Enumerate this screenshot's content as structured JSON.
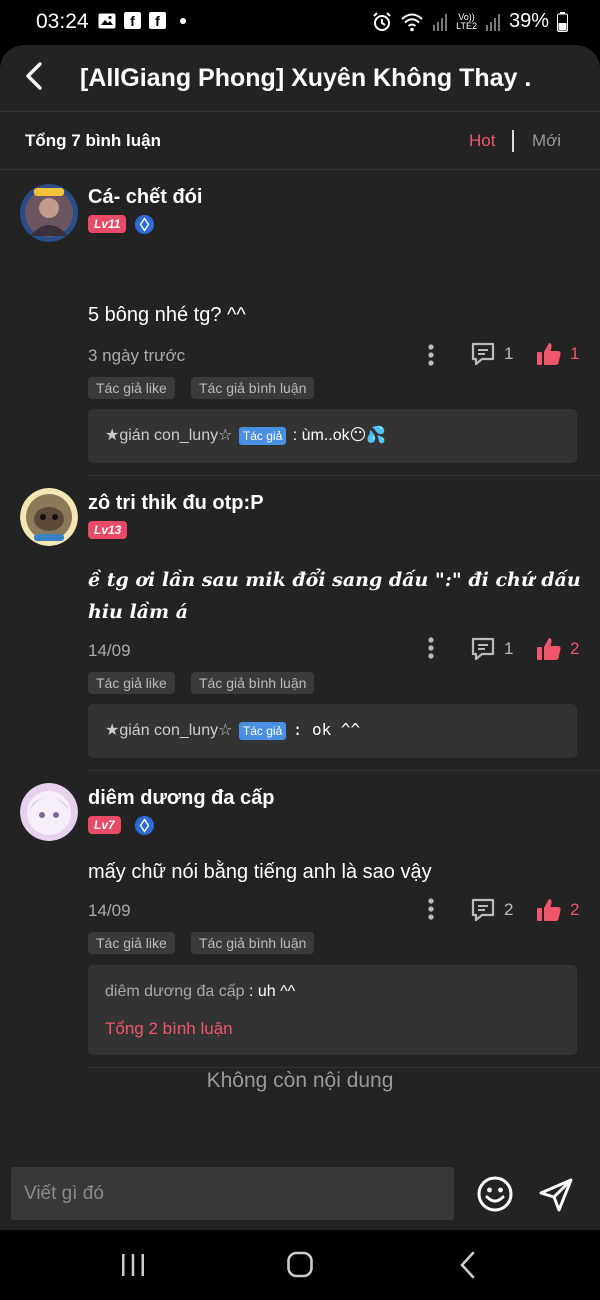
{
  "status_bar": {
    "time": "03:24",
    "app_icons": [
      "image-icon",
      "facebook-icon",
      "facebook-icon"
    ],
    "network_label_top": "Vo))",
    "network_label_bottom": "LTE2",
    "battery": "39%"
  },
  "header": {
    "title": "[AllGiang Phong] Xuyên Không Thay ..."
  },
  "comments_bar": {
    "count_label": "Tổng 7 bình luận",
    "sort_hot": "Hot",
    "sort_new": "Mới"
  },
  "comments": [
    {
      "username": "Cá- chết đói",
      "level": "Lv11",
      "content": "5 bông nhé tg? ^^",
      "time": "3 ngày trước",
      "reply_count": "1",
      "like_count": "1",
      "tags": [
        "Tác giả like",
        "Tác giả bình luận"
      ],
      "reply": {
        "user": "★gián con_luny☆",
        "badge": "Tác giả",
        "text": ": ùm..ok😶💦"
      }
    },
    {
      "username": "zô tri thik đu otp:P",
      "level": "Lv13",
      "content_line1": "ề tg ơi lần sau mik đổi sang dấu \":\" đi chứ dấu này hơi dễ bị",
      "content_line2": "hiu lầm á",
      "time": "14/09",
      "reply_count": "1",
      "like_count": "2",
      "tags": [
        "Tác giả like",
        "Tác giả bình luận"
      ],
      "reply": {
        "user": "★gián con_luny☆",
        "badge": "Tác giả",
        "text": ": ok ^^"
      }
    },
    {
      "username": "diêm dương đa cấp",
      "level": "Lv7",
      "content": "mấy chữ nói bằng tiếng anh là sao vậy",
      "time": "14/09",
      "reply_count": "2",
      "like_count": "2",
      "tags": [
        "Tác giả like",
        "Tác giả bình luận"
      ],
      "reply": {
        "user": "diêm dương đa cấp",
        "text": ": uh ^^",
        "total": "Tổng 2 bình luận"
      }
    }
  ],
  "end_text": "Không còn nội dung",
  "composer": {
    "placeholder": "Viết gì đó"
  },
  "colors": {
    "accent": "#f0566b",
    "background": "#232323",
    "level_badge": "#e94a66",
    "author_badge": "#4a90e2"
  }
}
